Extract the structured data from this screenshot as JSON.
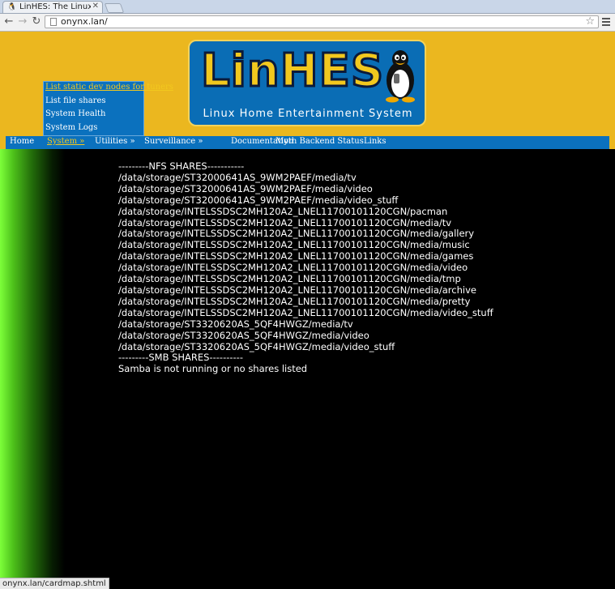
{
  "browser": {
    "tab_title": "LinHES: The Linux Hom",
    "url": "onynx.lan/",
    "status_url": "onynx.lan/cardmap.shtml"
  },
  "logo": {
    "title": "LinHES",
    "subtitle": "Linux Home Entertainment System"
  },
  "nav": {
    "items": [
      "Home",
      "System »",
      "Utilities »",
      "Surveillance »",
      "Documentation",
      "Myth Backend Status",
      "Links"
    ]
  },
  "dropdown": {
    "items": [
      "List static dev nodes for tuners",
      "List file shares",
      "System Health",
      "System Logs"
    ]
  },
  "content": {
    "lines": [
      "---------NFS SHARES-----------",
      "/data/storage/ST32000641AS_9WM2PAEF/media/tv",
      "/data/storage/ST32000641AS_9WM2PAEF/media/video",
      "/data/storage/ST32000641AS_9WM2PAEF/media/video_stuff",
      "/data/storage/INTELSSDSC2MH120A2_LNEL11700101120CGN/pacman",
      "/data/storage/INTELSSDSC2MH120A2_LNEL11700101120CGN/media/tv",
      "/data/storage/INTELSSDSC2MH120A2_LNEL11700101120CGN/media/gallery",
      "/data/storage/INTELSSDSC2MH120A2_LNEL11700101120CGN/media/music",
      "/data/storage/INTELSSDSC2MH120A2_LNEL11700101120CGN/media/games",
      "/data/storage/INTELSSDSC2MH120A2_LNEL11700101120CGN/media/video",
      "/data/storage/INTELSSDSC2MH120A2_LNEL11700101120CGN/media/tmp",
      "/data/storage/INTELSSDSC2MH120A2_LNEL11700101120CGN/media/archive",
      "/data/storage/INTELSSDSC2MH120A2_LNEL11700101120CGN/media/pretty",
      "/data/storage/INTELSSDSC2MH120A2_LNEL11700101120CGN/media/video_stuff",
      "/data/storage/ST3320620AS_5QF4HWGZ/media/tv",
      "/data/storage/ST3320620AS_5QF4HWGZ/media/video",
      "/data/storage/ST3320620AS_5QF4HWGZ/media/video_stuff",
      "---------SMB SHARES----------",
      "Samba is not running or no shares listed"
    ]
  },
  "colors": {
    "header_bg": "#ebb71f",
    "nav_bg": "#0b71be",
    "active_link": "#f2c81e",
    "page_bg": "#000000"
  }
}
